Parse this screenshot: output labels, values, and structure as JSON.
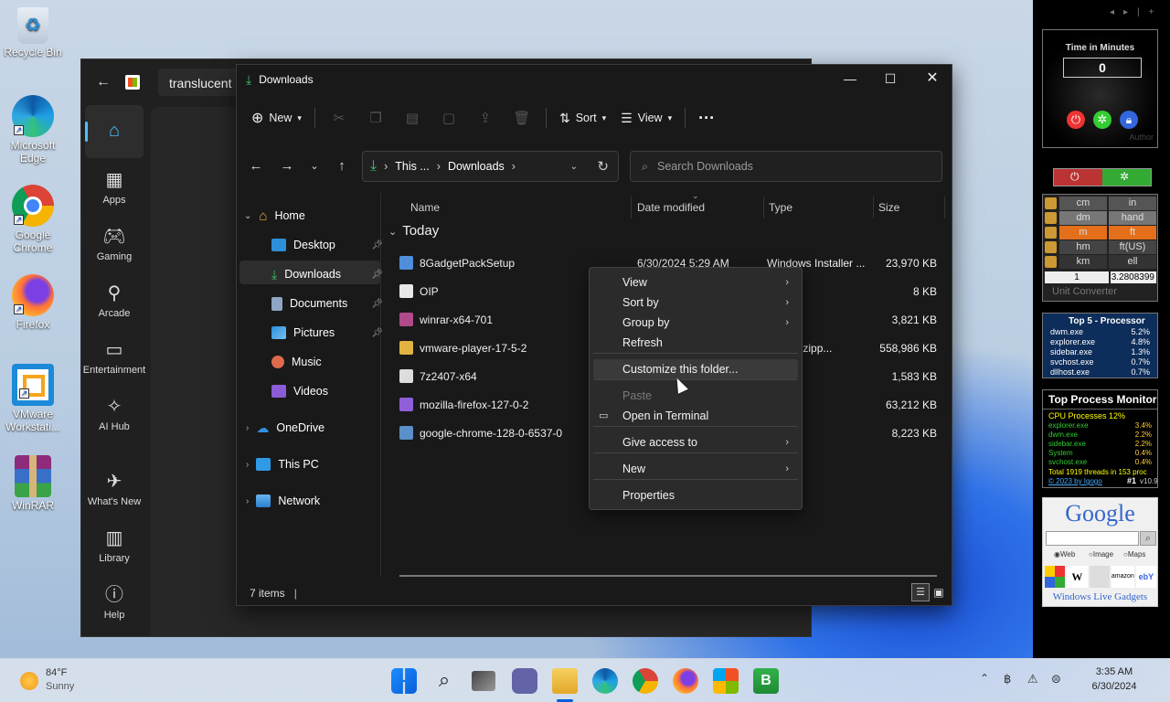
{
  "desktop_icons": [
    {
      "label": "Recycle Bin",
      "icon": "recycle-bin-icon"
    },
    {
      "label": "Microsoft Edge",
      "icon": "edge-icon"
    },
    {
      "label": "Google Chrome",
      "icon": "chrome-icon"
    },
    {
      "label": "Firefox",
      "icon": "firefox-icon"
    },
    {
      "label": "VMware Workstati...",
      "icon": "vmware-icon"
    },
    {
      "label": "WinRAR",
      "icon": "winrar-icon"
    }
  ],
  "store": {
    "title": "translucent",
    "rail": [
      {
        "label": "Home",
        "icon": "home-icon"
      },
      {
        "label": "Apps",
        "icon": "apps-icon"
      },
      {
        "label": "Gaming",
        "icon": "gamepad-icon"
      },
      {
        "label": "Arcade",
        "icon": "joystick-icon"
      },
      {
        "label": "Entertainment",
        "icon": "clapper-icon"
      },
      {
        "label": "AI Hub",
        "icon": "sparkle-icon"
      },
      {
        "label": "What's New",
        "icon": "rocket-icon"
      },
      {
        "label": "Library",
        "icon": "library-icon"
      },
      {
        "label": "Help",
        "icon": "help-icon"
      }
    ]
  },
  "explorer": {
    "title": "Downloads",
    "toolbar": {
      "new": "New",
      "sort": "Sort",
      "view": "View"
    },
    "address": {
      "segment1": "This ...",
      "segment2": "Downloads"
    },
    "search": {
      "placeholder": "Search Downloads"
    },
    "sidebar": {
      "home": "Home",
      "pinned": [
        "Desktop",
        "Downloads",
        "Documents",
        "Pictures",
        "Music",
        "Videos"
      ],
      "onedrive": "OneDrive",
      "thispc": "This PC",
      "network": "Network"
    },
    "columns": {
      "name": "Name",
      "date": "Date modified",
      "type": "Type",
      "size": "Size"
    },
    "group": "Today",
    "files": [
      {
        "name": "8GadgetPackSetup",
        "date": "6/30/2024 5:29 AM",
        "type": "Windows Installer ...",
        "size": "23,970 KB",
        "color": "#4f8edb"
      },
      {
        "name": "OIP",
        "date": "",
        "type": "e",
        "size": "8 KB",
        "color": "#e8e8e8"
      },
      {
        "name": "winrar-x64-701",
        "date": "",
        "type": "ation",
        "size": "3,821 KB",
        "color": "#b14a8a"
      },
      {
        "name": "vmware-player-17-5-2",
        "date": "",
        "type": "essed (zipp...",
        "size": "558,986 KB",
        "color": "#e3b341"
      },
      {
        "name": "7z2407-x64",
        "date": "",
        "type": "ation",
        "size": "1,583 KB",
        "color": "#dddddd"
      },
      {
        "name": "mozilla-firefox-127-0-2",
        "date": "",
        "type": "ation",
        "size": "63,212 KB",
        "color": "#8e5fd8"
      },
      {
        "name": "google-chrome-128-0-6537-0",
        "date": "",
        "type": "ation",
        "size": "8,223 KB",
        "color": "#5b8fc7"
      }
    ],
    "status": "7 items"
  },
  "context_menu": {
    "items": [
      {
        "label": "View",
        "submenu": true
      },
      {
        "label": "Sort by",
        "submenu": true
      },
      {
        "label": "Group by",
        "submenu": true
      },
      {
        "label": "Refresh",
        "submenu": false
      },
      {
        "label": "Customize this folder...",
        "submenu": false
      },
      {
        "label": "Paste",
        "submenu": false
      },
      {
        "label": "Open in Terminal",
        "submenu": false
      },
      {
        "label": "Give access to",
        "submenu": true
      },
      {
        "label": "New",
        "submenu": true
      },
      {
        "label": "Properties",
        "submenu": false
      }
    ]
  },
  "gadgets": {
    "timer": {
      "title": "Time in Minutes",
      "value": "0",
      "author": "Author"
    },
    "converter": {
      "rows": [
        [
          "cm",
          "in"
        ],
        [
          "dm",
          "hand"
        ],
        [
          "m",
          "ft"
        ],
        [
          "hm",
          "ft(US)"
        ],
        [
          "km",
          "ell"
        ]
      ],
      "input": "1",
      "output": "3.2808399",
      "title": "Unit Converter"
    },
    "top5": {
      "title": "Top 5 - Processor",
      "rows": [
        [
          "dwm.exe",
          "5.2%"
        ],
        [
          "explorer.exe",
          "4.8%"
        ],
        [
          "sidebar.exe",
          "1.3%"
        ],
        [
          "svchost.exe",
          "0.7%"
        ],
        [
          "dllhost.exe",
          "0.7%"
        ]
      ]
    },
    "tpm": {
      "title": "Top Process Monitor",
      "header": "CPU Processes 12%",
      "rows": [
        [
          "explorer.exe",
          "3.4%"
        ],
        [
          "dwm.exe",
          "2.2%"
        ],
        [
          "sidebar.exe",
          "2.2%"
        ],
        [
          "System",
          "0.4%"
        ],
        [
          "svchost.exe",
          "0.4%"
        ]
      ],
      "total": "Total 1919 threads in 153 proc",
      "credit": "© 2023 by Igogo",
      "rank": "#1",
      "version": "v10.9"
    },
    "google": {
      "logo": "Google",
      "options": [
        "Web",
        "Image",
        "Maps"
      ],
      "footer": "Windows Live Gadgets"
    }
  },
  "weather": {
    "temp": "84°F",
    "condition": "Sunny"
  },
  "clock": {
    "time": "3:35 AM",
    "date": "6/30/2024"
  }
}
